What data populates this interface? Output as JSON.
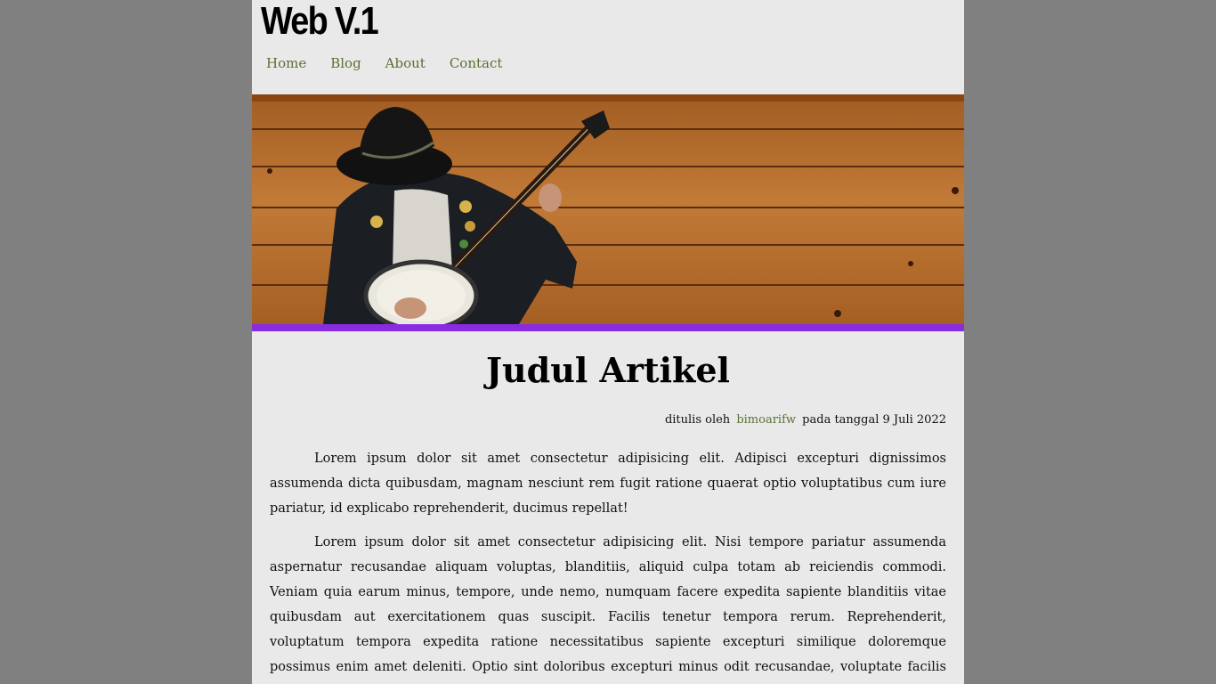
{
  "header": {
    "logo": "Web V.1",
    "nav": [
      "Home",
      "Blog",
      "About",
      "Contact"
    ]
  },
  "hero": {
    "image_icon": "banjo-player-image"
  },
  "article": {
    "title": "Judul Artikel",
    "meta_prefix": "ditulis oleh",
    "author": "bimoarifw",
    "meta_suffix": "pada tanggal 9 Juli 2022",
    "paragraphs": [
      "Lorem ipsum dolor sit amet consectetur adipisicing elit. Adipisci excepturi dignissimos assumenda dicta quibusdam, magnam nesciunt rem fugit ratione quaerat optio voluptatibus cum iure pariatur, id explicabo reprehenderit, ducimus repellat!",
      "Lorem ipsum dolor sit amet consectetur adipisicing elit. Nisi tempore pariatur assumenda aspernatur recusandae aliquam voluptas, blanditiis, aliquid culpa totam ab reiciendis commodi. Veniam quia earum minus, tempore, unde nemo, numquam facere expedita sapiente blanditiis vitae quibusdam aut exercitationem quas suscipit. Facilis tenetur tempora rerum. Reprehenderit, voluptatum tempora expedita ratione necessitatibus sapiente excepturi similique doloremque possimus enim amet deleniti. Optio sint doloribus excepturi minus odit recusandae, voluptate facilis magnam ex dolor, quod expedita"
    ]
  },
  "colors": {
    "background": "#808080",
    "page": "#e9e9e9",
    "link": "#5b7033",
    "hero_top_border": "#8b4513",
    "hero_bottom_border": "#8a2be2"
  }
}
